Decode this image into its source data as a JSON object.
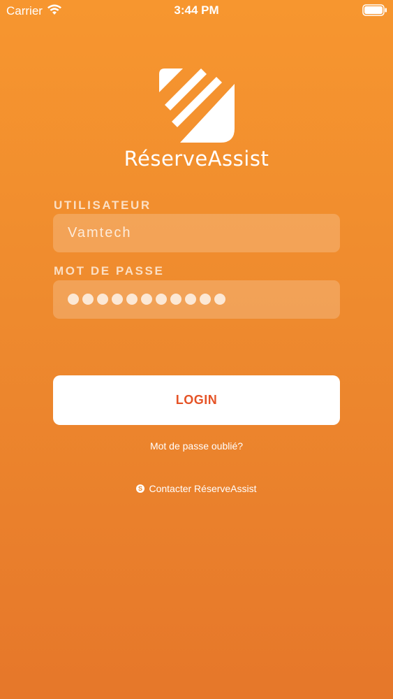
{
  "status_bar": {
    "carrier": "Carrier",
    "time": "3:44 PM",
    "icons": [
      "wifi-icon",
      "battery-icon"
    ]
  },
  "brand": {
    "name": "RéserveAssist",
    "logo_icon": "reserveassist-logo"
  },
  "form": {
    "username_label": "UTILISATEUR",
    "username_value": "Vamtech",
    "password_label": "MOT DE PASSE",
    "password_masked_length": 11
  },
  "actions": {
    "login_label": "LOGIN",
    "forgot_password": "Mot de passe oublié?",
    "contact_label": "Contacter RéserveAssist",
    "contact_icon": "skype-icon"
  },
  "colors": {
    "background_top": "#F7962F",
    "background_bottom": "#E6772A",
    "login_text": "#E55326",
    "button_bg": "#FFFFFF"
  }
}
